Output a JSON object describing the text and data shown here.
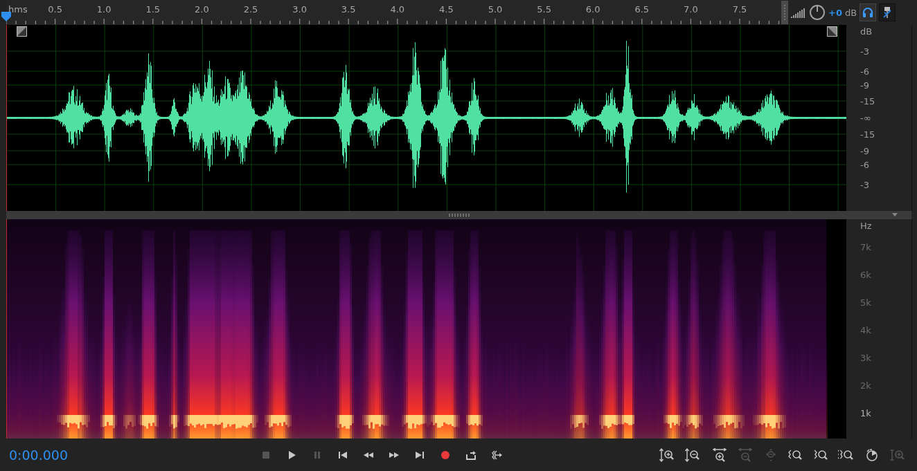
{
  "ruler": {
    "unit_label": "hms",
    "labels": [
      "0.5",
      "1.0",
      "1.5",
      "2.0",
      "2.5",
      "3.0",
      "3.5",
      "4.0",
      "4.5",
      "5.0",
      "5.5",
      "6.0",
      "6.5",
      "7.0",
      "7.5"
    ]
  },
  "output": {
    "gain": "+0",
    "unit": "dB"
  },
  "toggles": [
    {
      "kind": "headphones",
      "selected": true
    },
    {
      "kind": "pin",
      "selected": false
    }
  ],
  "amplitude_scale": {
    "unit": "dB",
    "labels": [
      "-3",
      "-6",
      "-9",
      "-15",
      "-∞",
      "-15",
      "-9",
      "-6",
      "-3"
    ]
  },
  "frequency_scale": {
    "unit": "Hz",
    "labels": [
      "7k",
      "6k",
      "5k",
      "4k",
      "3k",
      "2k",
      "1k"
    ]
  },
  "time_display": "0:00.000",
  "transport": [
    {
      "kind": "stop",
      "disabled": true
    },
    {
      "kind": "play",
      "disabled": false
    },
    {
      "kind": "pause",
      "disabled": true
    },
    {
      "kind": "skip-start",
      "disabled": false
    },
    {
      "kind": "rewind",
      "disabled": false
    },
    {
      "kind": "fast-forward",
      "disabled": false
    },
    {
      "kind": "skip-end",
      "disabled": false
    },
    {
      "kind": "record",
      "disabled": false
    },
    {
      "kind": "loop",
      "disabled": false
    },
    {
      "kind": "skip-selection",
      "disabled": false
    }
  ],
  "zoom_tools": [
    {
      "kind": "zoom-in-amplitude",
      "disabled": false
    },
    {
      "kind": "zoom-out-amplitude",
      "disabled": false
    },
    {
      "kind": "zoom-in-time",
      "disabled": false
    },
    {
      "kind": "zoom-out-time",
      "disabled": true
    },
    {
      "kind": "zoom-out-full",
      "disabled": true
    },
    {
      "kind": "zoom-in-left",
      "disabled": false
    },
    {
      "kind": "zoom-in-right",
      "disabled": false
    },
    {
      "kind": "zoom-selection",
      "disabled": false
    },
    {
      "kind": "zoom-clock",
      "disabled": false
    },
    {
      "kind": "zoom-reset-amplitude",
      "disabled": true
    }
  ]
}
